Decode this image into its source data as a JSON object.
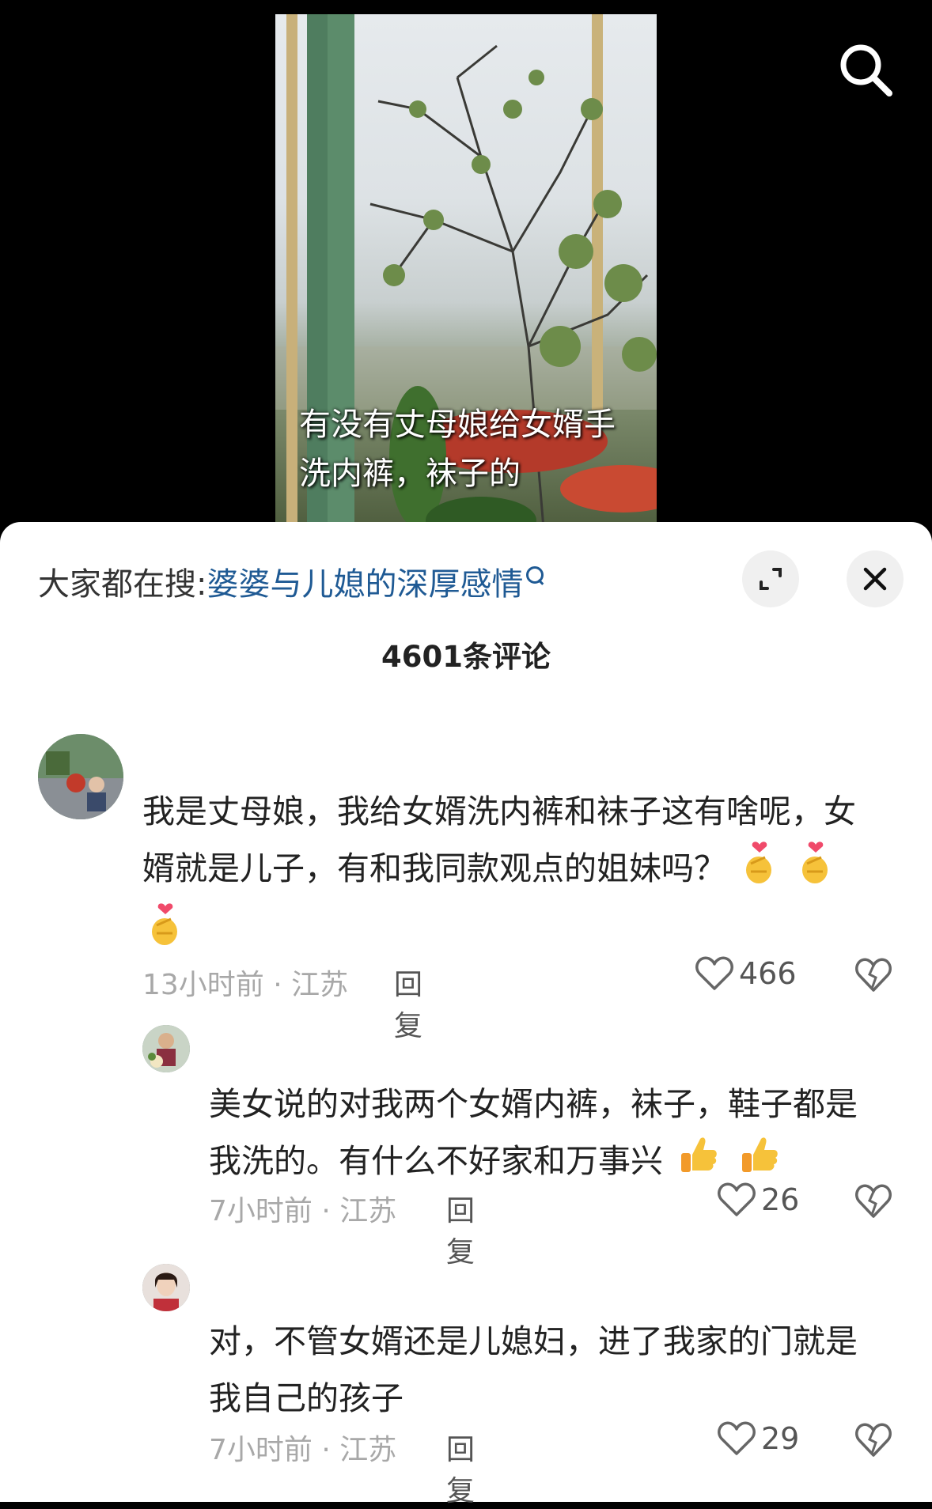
{
  "video": {
    "caption": "有没有丈母娘给女婿手洗内裤，袜子的",
    "search_icon": "search-icon"
  },
  "sheet": {
    "hot_search_label": "大家都在搜:",
    "hot_search_term": "婆婆与儿媳的深厚感情",
    "expand_icon": "expand-icon",
    "close_icon": "close-icon",
    "comment_count": "4601条评论"
  },
  "comments": [
    {
      "text": "我是丈母娘，我给女婿洗内裤和袜子这有啥呢，女婿就是儿子，有和我同款观点的姐妹吗？",
      "emojis": [
        "heart-hands-emoji",
        "heart-hands-emoji",
        "heart-hands-emoji"
      ],
      "meta": "13小时前 · 江苏",
      "reply": "回复",
      "likes": "466"
    },
    {
      "text": "美女说的对我两个女婿内裤，袜子，鞋子都是我洗的。有什么不好家和万事兴",
      "emojis": [
        "thumbs-up-emoji",
        "thumbs-up-emoji"
      ],
      "meta": "7小时前 · 江苏",
      "reply": "回复",
      "likes": "26"
    },
    {
      "text": "对，不管女婿还是儿媳妇，进了我家的门就是我自己的孩子",
      "meta": "7小时前 · 江苏",
      "reply": "回复",
      "likes": "29"
    }
  ],
  "colors": {
    "link": "#1f5a94",
    "meta": "#a8a8a8",
    "text": "#222222"
  }
}
